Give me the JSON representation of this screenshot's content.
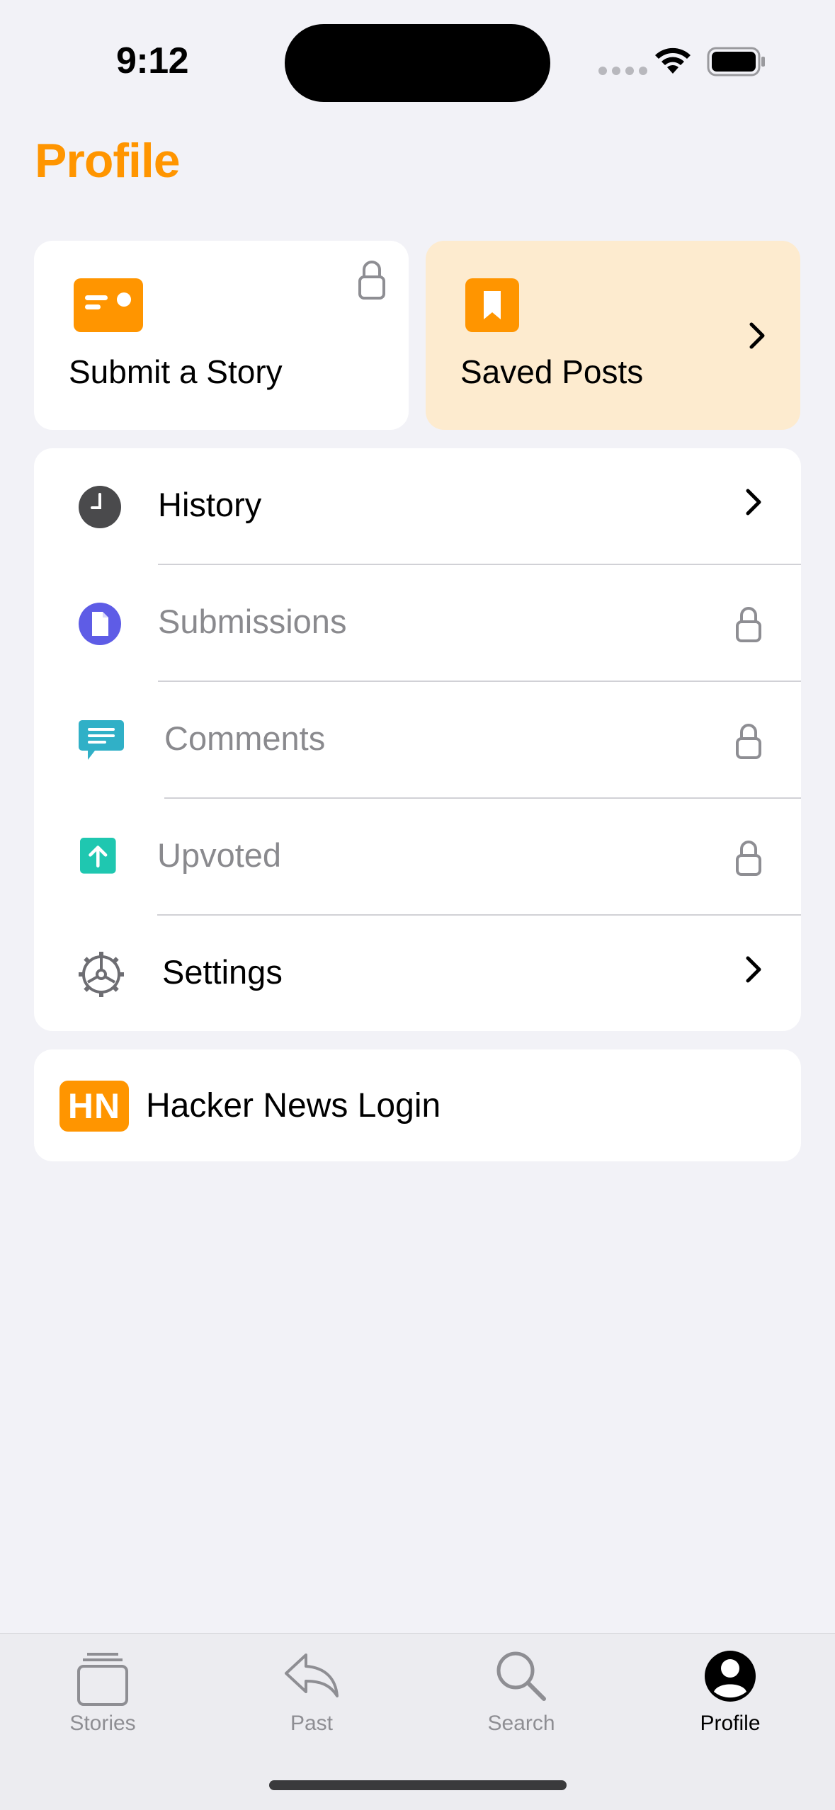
{
  "status_bar": {
    "time": "9:12"
  },
  "header": {
    "title": "Profile"
  },
  "cards": {
    "submit": {
      "label": "Submit a Story",
      "locked": true,
      "icon": "id-card-icon"
    },
    "saved": {
      "label": "Saved Posts",
      "icon": "bookmark-icon"
    }
  },
  "menu": {
    "items": [
      {
        "label": "History",
        "icon": "clock-icon",
        "enabled": true
      },
      {
        "label": "Submissions",
        "icon": "document-icon",
        "enabled": false
      },
      {
        "label": "Comments",
        "icon": "comment-bubble-icon",
        "enabled": false
      },
      {
        "label": "Upvoted",
        "icon": "upvote-arrow-icon",
        "enabled": false
      },
      {
        "label": "Settings",
        "icon": "gear-icon",
        "enabled": true
      }
    ]
  },
  "login": {
    "icon_text": "HN",
    "label": "Hacker News Login"
  },
  "tabbar": {
    "tabs": [
      {
        "label": "Stories",
        "active": false
      },
      {
        "label": "Past",
        "active": false
      },
      {
        "label": "Search",
        "active": false
      },
      {
        "label": "Profile",
        "active": true
      }
    ]
  },
  "colors": {
    "accent": "#ff9500",
    "saved_card_bg": "#fdebcf",
    "submissions_icon": "#5e5ce6",
    "comments_icon": "#30b0c7",
    "upvoted_icon": "#1fc7b0",
    "disabled_text": "#8a8a8e"
  }
}
